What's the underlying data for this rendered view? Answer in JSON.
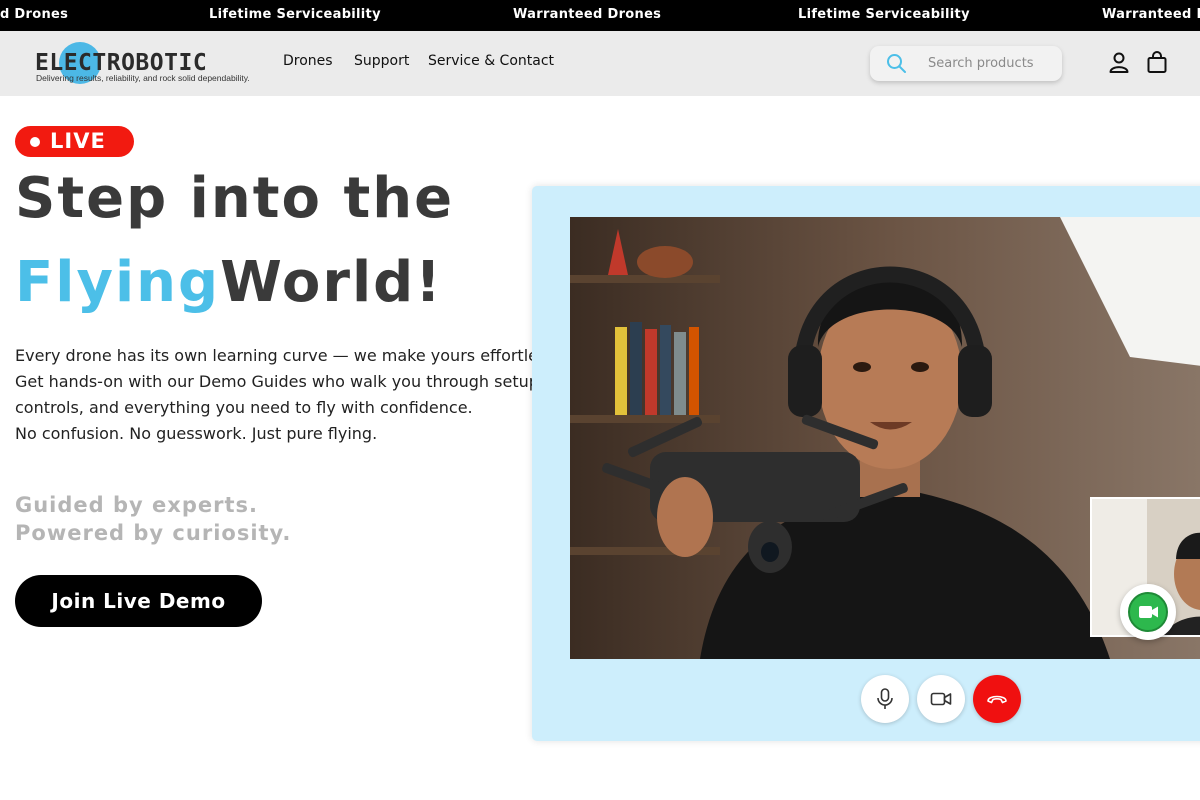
{
  "announcement": {
    "items": [
      "d Drones",
      "Lifetime Serviceability",
      "Warranteed Drones",
      "Lifetime Serviceability",
      "Warranteed D"
    ]
  },
  "brand": {
    "name": "ELECTROBOTIC",
    "tagline": "Delivering results, reliability, and rock solid dependability."
  },
  "nav": {
    "drones": "Drones",
    "support": "Support",
    "service_contact": "Service & Contact"
  },
  "search": {
    "placeholder": "Search products"
  },
  "hero": {
    "badge": "LIVE",
    "title_line1": "Step into the",
    "title_accent": "Flying",
    "title_rest": "World!",
    "paragraph": [
      "Every drone has its own learning curve — we make yours effortless.",
      "Get hands-on with our Demo Guides who walk you through setup,",
      "controls, and everything you need to fly with confidence.",
      "No confusion. No guesswork. Just pure flying."
    ],
    "subline1": "Guided by experts.",
    "subline2": "Powered by curiosity.",
    "cta": "Join Live Demo"
  },
  "call": {
    "controls": [
      "microphone-icon",
      "video-camera-icon",
      "end-call-icon"
    ]
  },
  "colors": {
    "accent": "#4cbfe8",
    "live_red": "#f21a10",
    "panel_bg": "#cdeefc",
    "chat_green": "#2db84d"
  }
}
